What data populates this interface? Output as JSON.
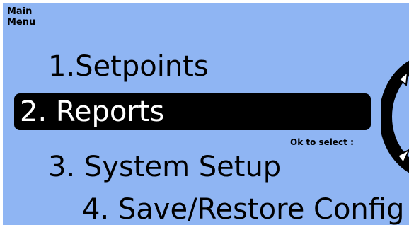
{
  "header": {
    "line1": "Main",
    "line2": "Menu"
  },
  "menu": {
    "items": [
      {
        "label": "1.Setpoints",
        "selected": false
      },
      {
        "label": "2. Reports",
        "selected": true
      },
      {
        "label": "3. System Setup",
        "selected": false
      },
      {
        "label": "4. Save/Restore Config",
        "selected": false
      }
    ]
  },
  "hint": {
    "text": "Ok to select :"
  },
  "colors": {
    "screen_background": "#8fb5f3",
    "highlight": "#000000",
    "highlight_text": "#ffffff"
  },
  "icons": {
    "dial": "navigation-dial-icon"
  }
}
